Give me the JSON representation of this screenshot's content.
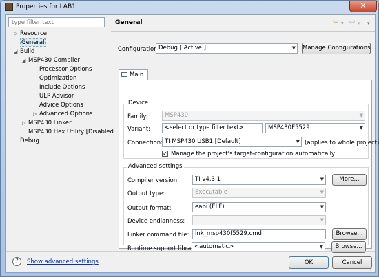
{
  "window": {
    "title": "Properties for LAB1",
    "close_glyph": "✕"
  },
  "filter": {
    "placeholder": "type filter text"
  },
  "tree": [
    {
      "label": "Resource",
      "toggle": "▷"
    },
    {
      "label": "General",
      "toggle": ""
    },
    {
      "label": "Build",
      "toggle": "◢"
    },
    {
      "label": "MSP430 Compiler",
      "toggle": "◢"
    },
    {
      "label": "Processor Options",
      "toggle": ""
    },
    {
      "label": "Optimization",
      "toggle": ""
    },
    {
      "label": "Include Options",
      "toggle": ""
    },
    {
      "label": "ULP Advisor",
      "toggle": ""
    },
    {
      "label": "Advice Options",
      "toggle": ""
    },
    {
      "label": "Advanced Options",
      "toggle": "▷"
    },
    {
      "label": "MSP430 Linker",
      "toggle": "▷"
    },
    {
      "label": "MSP430 Hex Utility  [Disabled",
      "toggle": ""
    },
    {
      "label": "Debug",
      "toggle": ""
    }
  ],
  "header": {
    "title": "General",
    "back": "⇦",
    "forward": "⇨",
    "menu": "▾"
  },
  "configuration": {
    "label": "Configuration:",
    "value": "Debug  [ Active ]",
    "manage_button": "Manage Configurations..."
  },
  "tab": {
    "label": "Main"
  },
  "device": {
    "group_title": "Device",
    "family_label": "Family:",
    "family_value": "MSP430",
    "variant_label": "Variant:",
    "variant_filter": "<select or type filter text>",
    "variant_value": "MSP430F5529",
    "connection_label": "Connection:",
    "connection_value": "TI MSP430 USB1 [Default]",
    "connection_note": "(applies to whole project)",
    "manage_checkbox_label": "Manage the project's target-configuration automatically",
    "manage_checked": "✓"
  },
  "advanced": {
    "group_title": "Advanced settings",
    "compiler_label": "Compiler version:",
    "compiler_value": "TI v4.3.1",
    "more_button": "More...",
    "output_type_label": "Output type:",
    "output_type_value": "Executable",
    "output_format_label": "Output format:",
    "output_format_value": "eabi (ELF)",
    "endianness_label": "Device endianness:",
    "endianness_value": "",
    "linker_label": "Linker command file:",
    "linker_value": "lnk_msp430f5529.cmd",
    "linker_browse": "Browse...",
    "runtime_label": "Runtime support library:",
    "runtime_value": "<automatic>",
    "runtime_browse": "Browse..."
  },
  "footer": {
    "help_glyph": "?",
    "advanced_link": "Show advanced settings",
    "ok": "OK",
    "cancel": "Cancel"
  }
}
